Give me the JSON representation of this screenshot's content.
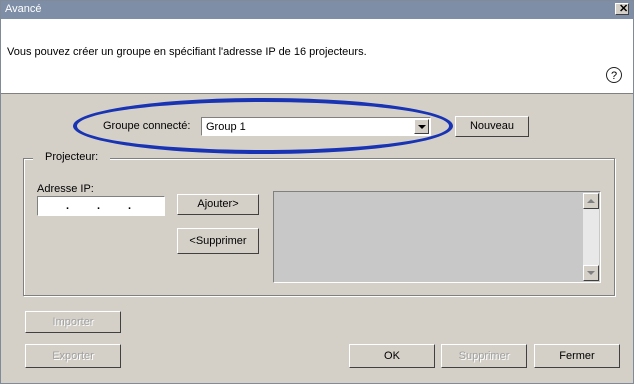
{
  "window": {
    "title": "Avancé",
    "close_glyph": "✕"
  },
  "top_panel": {
    "description": "Vous pouvez créer un groupe en spécifiant l'adresse IP de 16 projecteurs.",
    "help_glyph": "?"
  },
  "group": {
    "label": "Groupe connecté:",
    "selected": "Group 1",
    "new_button": "Nouveau"
  },
  "projector": {
    "legend": "Projecteur:",
    "ip_label": "Adresse IP:",
    "add_button": "Ajouter>",
    "remove_button": "<Supprimer"
  },
  "bottom": {
    "import_button": "Importer",
    "export_button": "Exporter",
    "ok_button": "OK",
    "delete_button": "Supprimer",
    "close_button": "Fermer"
  },
  "colors": {
    "highlight_oval": "#1833b4",
    "titlebar": "#7d8ea6"
  },
  "icons": {
    "help": "help-icon",
    "close": "close-icon",
    "dropdown": "chevron-down-icon"
  }
}
